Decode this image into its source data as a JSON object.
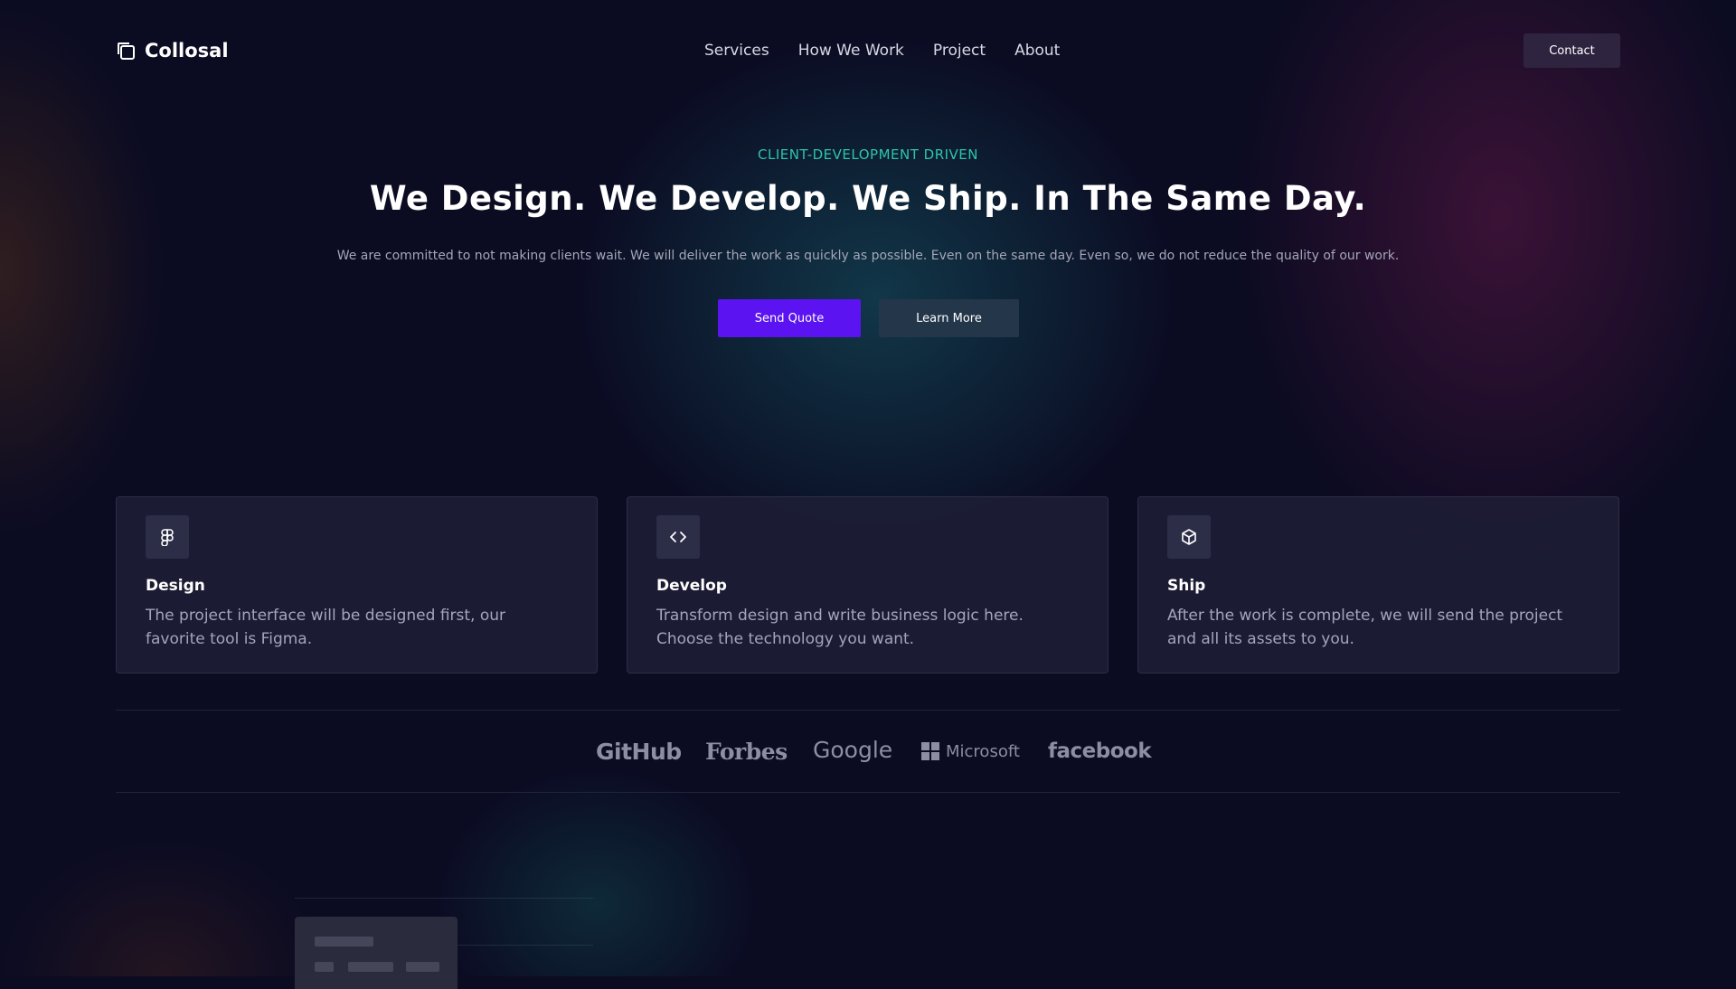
{
  "brand": {
    "name": "Collosal",
    "icon": "copy-icon"
  },
  "nav": {
    "items": [
      {
        "label": "Services"
      },
      {
        "label": "How We Work"
      },
      {
        "label": "Project"
      },
      {
        "label": "About"
      }
    ],
    "contact_label": "Contact"
  },
  "hero": {
    "eyebrow": "CLIENT-DEVELOPMENT DRIVEN",
    "title": "We Design. We Develop. We Ship. In The Same Day.",
    "subtitle": "We are committed to not making clients wait. We will deliver the work as quickly as possible. Even on the same day. Even so, we do not reduce the quality of our work.",
    "primary_label": "Send Quote",
    "secondary_label": "Learn More"
  },
  "features": [
    {
      "icon": "figma-icon",
      "title": "Design",
      "description": "The project interface will be designed first, our favorite tool is Figma."
    },
    {
      "icon": "code-icon",
      "title": "Develop",
      "description": "Transform design and write business logic here. Choose the technology you want."
    },
    {
      "icon": "box-icon",
      "title": "Ship",
      "description": "After the work is complete, we will send the project and all its assets to you."
    }
  ],
  "logos": [
    {
      "name": "GitHub"
    },
    {
      "name": "Forbes"
    },
    {
      "name": "Google"
    },
    {
      "name": "Microsoft"
    },
    {
      "name": "facebook"
    }
  ],
  "colors": {
    "background": "#0b0b22",
    "accent": "#5b14f1",
    "eyebrow": "#2dc5a8",
    "secondary_button": "#23364a",
    "contact_button": "#2f2440",
    "card": "#202038"
  }
}
